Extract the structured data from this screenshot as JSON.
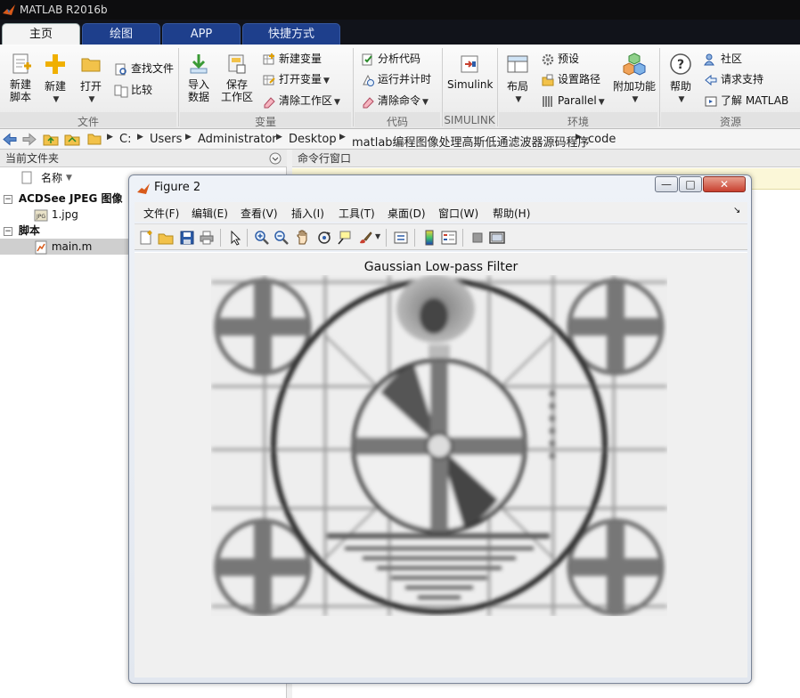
{
  "window": {
    "title": "MATLAB R2016b"
  },
  "tabs": [
    {
      "label": "主页",
      "active": true
    },
    {
      "label": "绘图",
      "active": false
    },
    {
      "label": "APP",
      "active": false
    },
    {
      "label": "快捷方式",
      "active": false
    }
  ],
  "ribbon": {
    "file": {
      "group": "文件",
      "new_script": "新建\n脚本",
      "new": "新建",
      "open": "打开",
      "find_files": "查找文件",
      "compare": "比较"
    },
    "variable": {
      "group": "变量",
      "import_data": "导入\n数据",
      "save_workspace": "保存\n工作区",
      "new_variable": "新建变量",
      "open_variable": "打开变量",
      "clear_workspace": "清除工作区"
    },
    "code": {
      "group": "代码",
      "analyze_code": "分析代码",
      "run_and_time": "运行并计时",
      "clear_commands": "清除命令"
    },
    "simulink": {
      "group": "SIMULINK",
      "label": "Simulink"
    },
    "environment": {
      "group": "环境",
      "layout": "布局",
      "preferences": "预设",
      "set_path": "设置路径",
      "parallel": "Parallel",
      "addons": "附加功能"
    },
    "resources": {
      "group": "资源",
      "help": "帮助",
      "community": "社区",
      "request_support": "请求支持",
      "learn_matlab": "了解 MATLAB"
    }
  },
  "address": {
    "crumbs": [
      "C:",
      "Users",
      "Administrator",
      "Desktop",
      "matlab编程图像处理高斯低通滤波器源码程序",
      "code"
    ]
  },
  "current_folder": {
    "title": "当前文件夹",
    "column_name": "名称",
    "groups": [
      {
        "label": "ACDSee JPEG 图像",
        "files": [
          "1.jpg"
        ]
      },
      {
        "label": "脚本",
        "files": [
          "main.m"
        ]
      }
    ]
  },
  "command_window": {
    "title": "命令行窗口"
  },
  "figure": {
    "title": "Figure 2",
    "menu": [
      "文件(F)",
      "编辑(E)",
      "查看(V)",
      "插入(I)",
      "工具(T)",
      "桌面(D)",
      "窗口(W)",
      "帮助(H)"
    ],
    "axes_title": "Gaussian Low-pass Filter",
    "window_buttons": {
      "minimize": "—",
      "maximize": "□",
      "close": "✕"
    }
  },
  "colors": {
    "tab_bar": "#11131a",
    "tab": "#1e3f8c",
    "figure_border": "#7a8598",
    "close_button": "#c8402f",
    "matlab_orange": "#d85a1a"
  }
}
